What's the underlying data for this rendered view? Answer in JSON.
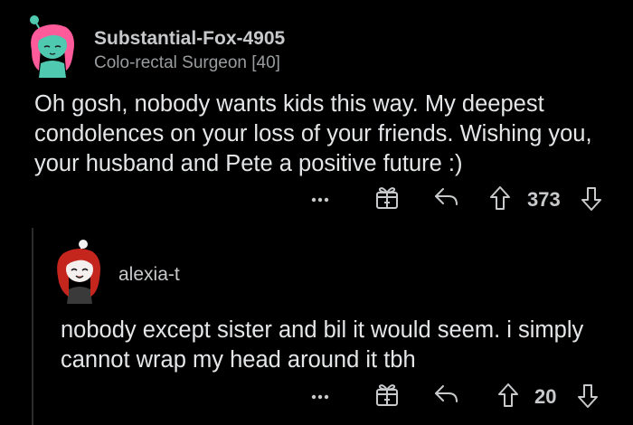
{
  "comments": [
    {
      "username": "Substantial-Fox-4905",
      "flair": "Colo-rectal Surgeon [40]",
      "body": "Oh gosh, nobody wants kids this way. My deepest condolences on your loss of your friends. Wishing you, your husband and Pete a positive future :)",
      "votes": "373"
    },
    {
      "username": "alexia-t",
      "body": "nobody except sister and bil it would seem. i simply cannot wrap my head around it tbh",
      "votes": "20"
    }
  ],
  "icons": {
    "more": "more-options-icon",
    "award": "award-gift-icon",
    "reply": "reply-arrow-icon",
    "upvote": "upvote-arrow-icon",
    "downvote": "downvote-arrow-icon"
  },
  "colors": {
    "background": "#000000",
    "avatar1_skin": "#4fc9b0",
    "avatar1_hair": "#ff5a9a",
    "avatar2_hair": "#c4261e"
  }
}
